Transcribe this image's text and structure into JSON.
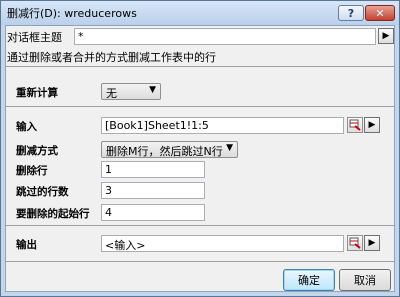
{
  "window": {
    "title": "删减行(D): wreducerows"
  },
  "titlebar": {
    "help": "?",
    "close": "✕"
  },
  "theme": {
    "label": "对话框主题",
    "value": "*"
  },
  "description": "通过删除或者合并的方式删减工作表中的行",
  "recalc": {
    "label": "重新计算",
    "value": "无"
  },
  "input": {
    "label": "输入",
    "value": "[Book1]Sheet1!1:5"
  },
  "method": {
    "label": "删减方式",
    "value": "删除M行，然后跳过N行"
  },
  "delete_rows": {
    "label": "删除行",
    "value": "1"
  },
  "skip_rows": {
    "label": "跳过的行数",
    "value": "3"
  },
  "start_row": {
    "label": "要删除的起始行",
    "value": "4"
  },
  "output": {
    "label": "输出",
    "value": "<输入>"
  },
  "buttons": {
    "ok": "确定",
    "cancel": "取消"
  },
  "icons": {
    "range_select": "range-select-icon",
    "arrow": "right-arrow-icon"
  }
}
